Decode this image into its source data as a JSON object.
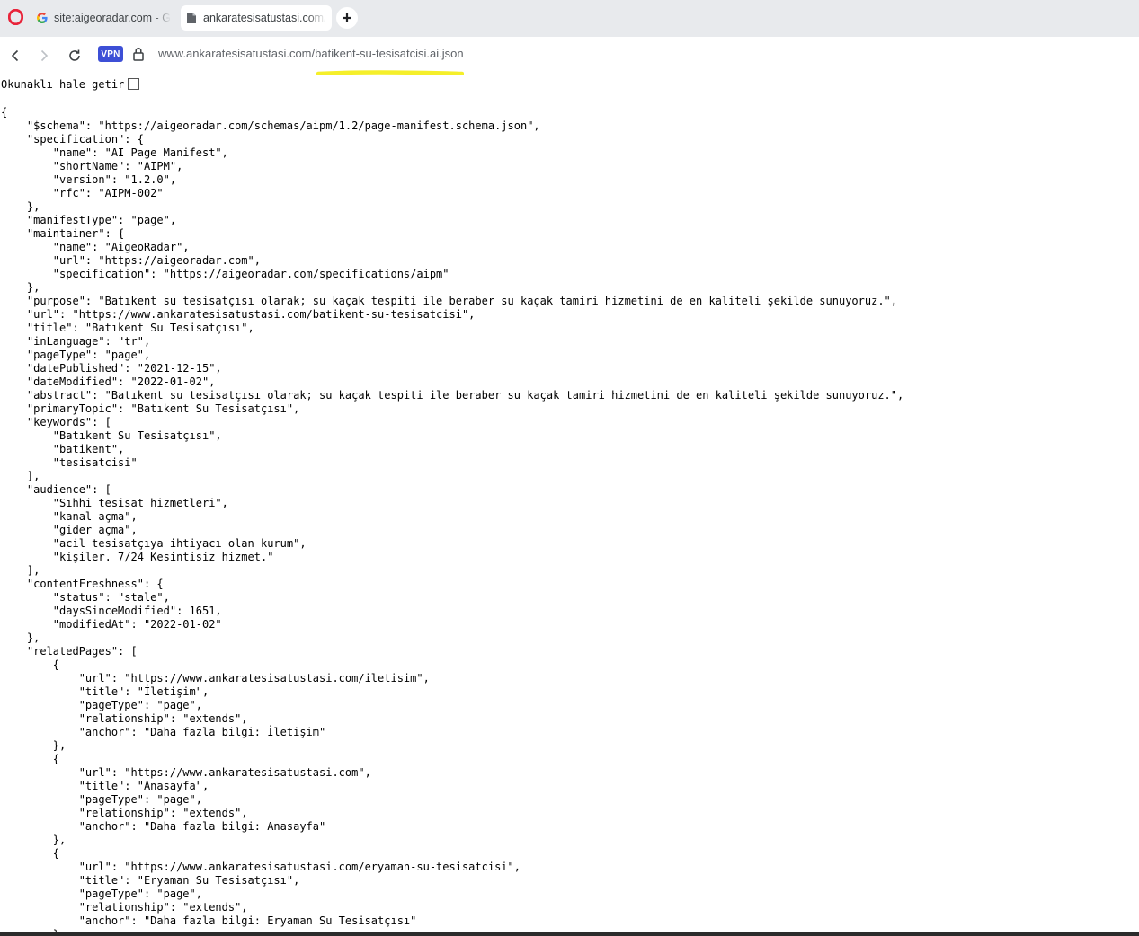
{
  "browser": {
    "tabs": [
      {
        "label": "site:aigeoradar.com - Google",
        "favicon": "google-g-icon",
        "active": false
      },
      {
        "label": "ankaratesisatustasi.com/batikent-su-tesisatcisi.ai.json",
        "favicon": "document-icon",
        "active": true
      }
    ],
    "new_tab_icon": "plus-icon",
    "vpn_label": "VPN",
    "url_host": "www.ankaratesisatustasi.com",
    "url_path": "/batikent-su-tesisatcisi.ai.json",
    "accent": "#3d4fd6",
    "highlight_color": "#f5ef2a"
  },
  "pretty_print": {
    "label": "Okunaklı hale getir",
    "checked": false
  },
  "json_lines": [
    "{",
    "    \"$schema\": \"https://aigeoradar.com/schemas/aipm/1.2/page-manifest.schema.json\",",
    "    \"specification\": {",
    "        \"name\": \"AI Page Manifest\",",
    "        \"shortName\": \"AIPM\",",
    "        \"version\": \"1.2.0\",",
    "        \"rfc\": \"AIPM-002\"",
    "    },",
    "    \"manifestType\": \"page\",",
    "    \"maintainer\": {",
    "        \"name\": \"AigeoRadar\",",
    "        \"url\": \"https://aigeoradar.com\",",
    "        \"specification\": \"https://aigeoradar.com/specifications/aipm\"",
    "    },",
    "    \"purpose\": \"Batıkent su tesisatçısı olarak; su kaçak tespiti ile beraber su kaçak tamiri hizmetini de en kaliteli şekilde sunuyoruz.\",",
    "    \"url\": \"https://www.ankaratesisatustasi.com/batikent-su-tesisatcisi\",",
    "    \"title\": \"Batıkent Su Tesisatçısı\",",
    "    \"inLanguage\": \"tr\",",
    "    \"pageType\": \"page\",",
    "    \"datePublished\": \"2021-12-15\",",
    "    \"dateModified\": \"2022-01-02\",",
    "    \"abstract\": \"Batıkent su tesisatçısı olarak; su kaçak tespiti ile beraber su kaçak tamiri hizmetini de en kaliteli şekilde sunuyoruz.\",",
    "    \"primaryTopic\": \"Batıkent Su Tesisatçısı\",",
    "    \"keywords\": [",
    "        \"Batıkent Su Tesisatçısı\",",
    "        \"batikent\",",
    "        \"tesisatcisi\"",
    "    ],",
    "    \"audience\": [",
    "        \"Sıhhi tesisat hizmetleri\",",
    "        \"kanal açma\",",
    "        \"gider açma\",",
    "        \"acil tesisatçıya ihtiyacı olan kurum\",",
    "        \"kişiler. 7/24 Kesintisiz hizmet.\"",
    "    ],",
    "    \"contentFreshness\": {",
    "        \"status\": \"stale\",",
    "        \"daysSinceModified\": 1651,",
    "        \"modifiedAt\": \"2022-01-02\"",
    "    },",
    "    \"relatedPages\": [",
    "        {",
    "            \"url\": \"https://www.ankaratesisatustasi.com/iletisim\",",
    "            \"title\": \"İletişim\",",
    "            \"pageType\": \"page\",",
    "            \"relationship\": \"extends\",",
    "            \"anchor\": \"Daha fazla bilgi: İletişim\"",
    "        },",
    "        {",
    "            \"url\": \"https://www.ankaratesisatustasi.com\",",
    "            \"title\": \"Anasayfa\",",
    "            \"pageType\": \"page\",",
    "            \"relationship\": \"extends\",",
    "            \"anchor\": \"Daha fazla bilgi: Anasayfa\"",
    "        },",
    "        {",
    "            \"url\": \"https://www.ankaratesisatustasi.com/eryaman-su-tesisatcisi\",",
    "            \"title\": \"Eryaman Su Tesisatçısı\",",
    "            \"pageType\": \"page\",",
    "            \"relationship\": \"extends\",",
    "            \"anchor\": \"Daha fazla bilgi: Eryaman Su Tesisatçısı\"",
    "        },"
  ]
}
